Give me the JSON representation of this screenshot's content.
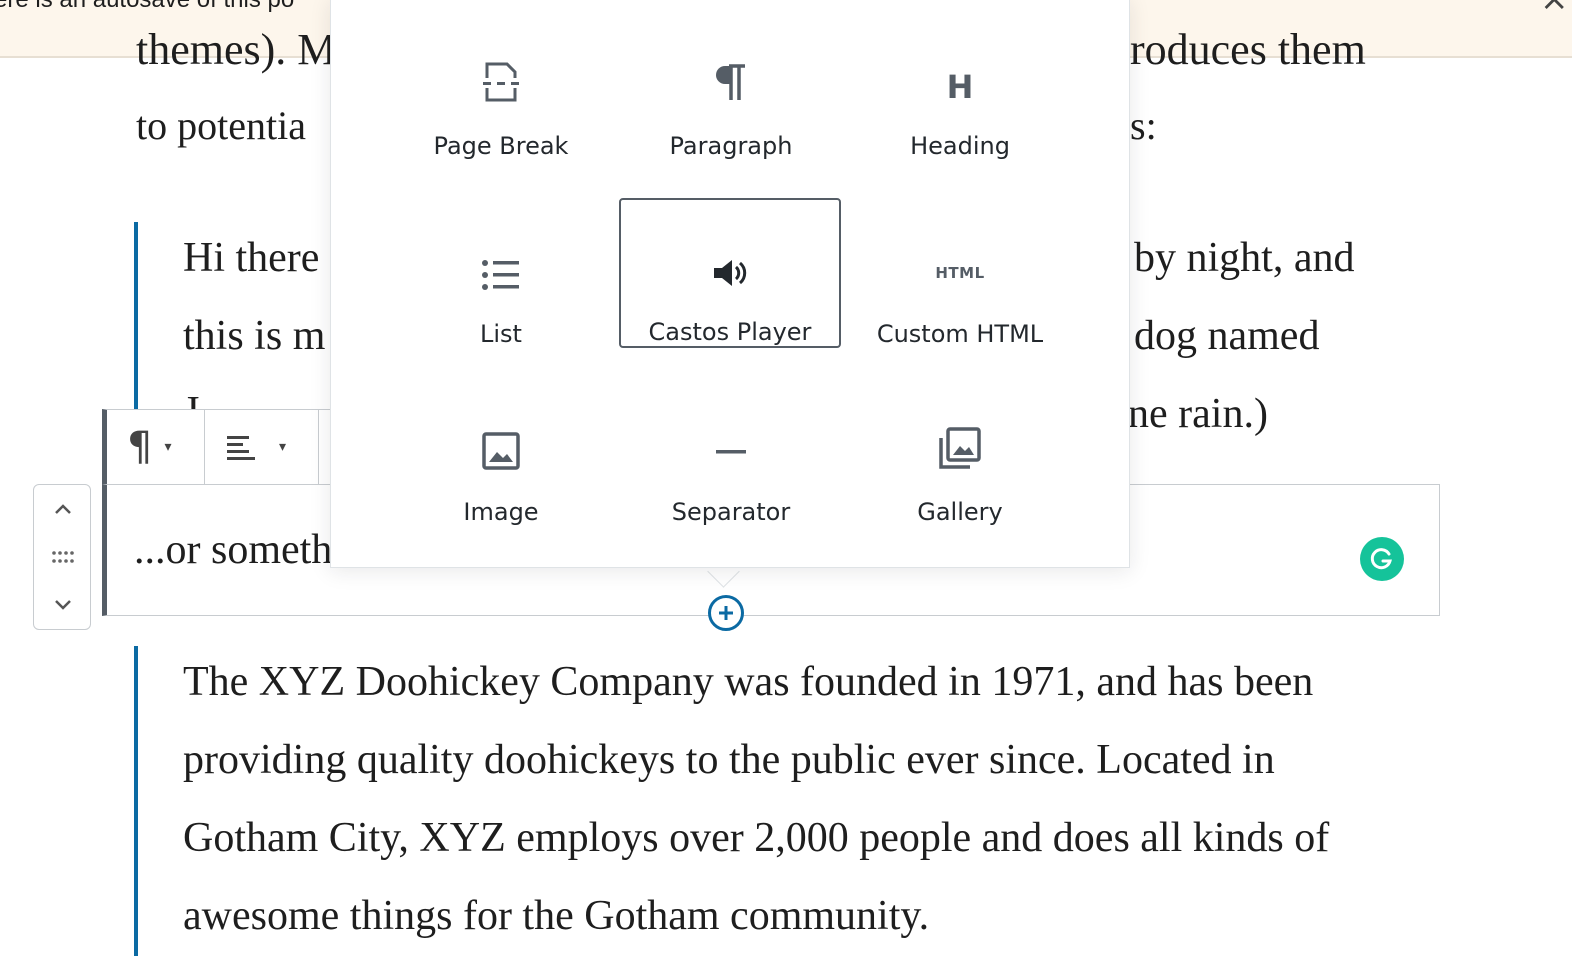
{
  "notice": {
    "text": "ere is an autosave of this po",
    "close_glyph": "×"
  },
  "intro": {
    "top_fragment": "themes). M",
    "top_tail": "roduces them",
    "line2_fragment": "to potentia",
    "line2_tail": "s:"
  },
  "quote1": {
    "lines_left": [
      "Hi there",
      "this is m",
      "J"
    ],
    "lines_right": [
      "by night, and",
      "dog named",
      "ne rain.)"
    ]
  },
  "toolbar": {
    "paragraph_glyph": "¶",
    "caret_glyph": "▾"
  },
  "mover": {
    "up_glyph": "⌃",
    "drag_glyph": "⋮⋮",
    "down_glyph": "⌄"
  },
  "selected_block": {
    "text": "...or someth"
  },
  "inserter": {
    "blocks": [
      {
        "label": "Page Break",
        "icon": "page-break-icon"
      },
      {
        "label": "Paragraph",
        "icon": "paragraph-icon"
      },
      {
        "label": "Heading",
        "icon": "heading-icon",
        "glyph": "H"
      },
      {
        "label": "List",
        "icon": "list-icon"
      },
      {
        "label": "Castos Player",
        "icon": "speaker-icon",
        "selected": true
      },
      {
        "label": "Custom HTML",
        "icon": "html-icon",
        "glyph": "HTML"
      },
      {
        "label": "Image",
        "icon": "image-icon"
      },
      {
        "label": "Separator",
        "icon": "separator-icon"
      },
      {
        "label": "Gallery",
        "icon": "gallery-icon"
      }
    ]
  },
  "quote2": {
    "lines": [
      "The XYZ Doohickey Company was founded in 1971, and has been",
      "providing quality doohickeys to the public ever since. Located in",
      "Gotham City, XYZ employs over 2,000 people and does all kinds of",
      "awesome things for the Gotham community."
    ]
  },
  "colors": {
    "accent": "#0b6aa3",
    "notice_bg": "#fdf6ec",
    "grammarly": "#15c39a",
    "toolbar_border": "#555d66"
  }
}
